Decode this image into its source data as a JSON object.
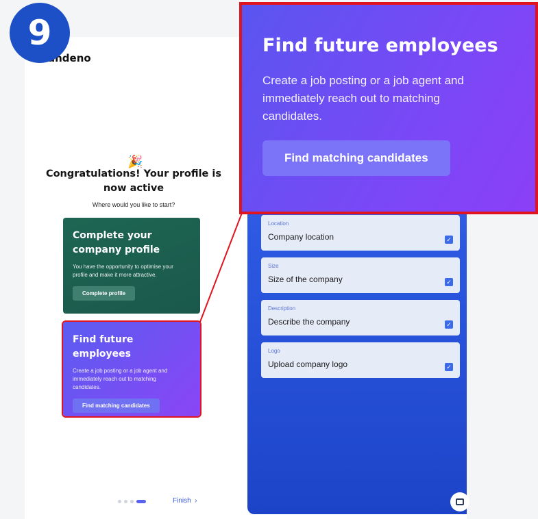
{
  "step_badge": "9",
  "brand": "andeno",
  "welcome": {
    "emoji": "🎉",
    "title": "Congratulations! Your profile is now active",
    "subtitle": "Where would you like to start?"
  },
  "cards": [
    {
      "title": "Complete your company profile",
      "text": "You have the opportunity to optimise your profile and make it more attractive.",
      "button": "Complete profile"
    },
    {
      "title": "Find future employees",
      "text": "Create a job posting or a job agent and immediately reach out to matching candidates.",
      "button": "Find matching candidates"
    }
  ],
  "pager": {
    "total": 4,
    "current": 4,
    "finish_label": "Finish",
    "finish_icon": "chevron-right-icon"
  },
  "checklist": [
    {
      "label": "Location",
      "value": "Company location",
      "checked": true
    },
    {
      "label": "Size",
      "value": "Size of the company",
      "checked": true
    },
    {
      "label": "Description",
      "value": "Describe the company",
      "checked": true
    },
    {
      "label": "Logo",
      "value": "Upload company logo",
      "checked": true
    }
  ],
  "zoom": {
    "title": "Find future employees",
    "text": "Create a job posting or a job agent and immediately reach out to matching candidates.",
    "button": "Find matching candidates"
  },
  "colors": {
    "green_card": "#1e6653",
    "purple_card": "#5b5cf1",
    "panel_blue": "#2f5ce6",
    "highlight": "#e0141e",
    "badge": "#1d4fc7"
  }
}
